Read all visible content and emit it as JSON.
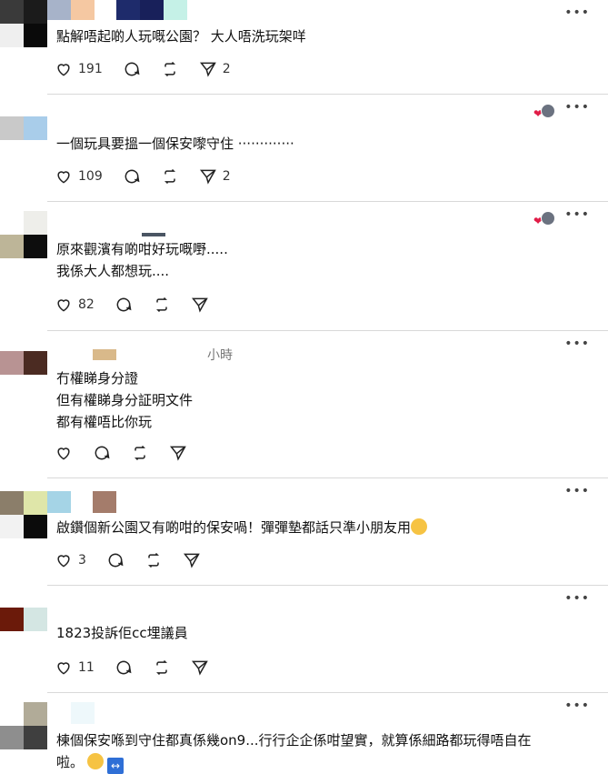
{
  "posts": [
    {
      "text": "點解唔起啲人玩嘅公園？ 大人唔洗玩架咩",
      "likes": "191",
      "shares": "2",
      "has_reactions": false
    },
    {
      "text": "一個玩具要搵一個保安嚟守住 ·············",
      "likes": "109",
      "shares": "2",
      "has_reactions": true
    },
    {
      "text": "原來觀濱有啲咁好玩嘅嘢.....\n我係大人都想玩....",
      "likes": "82",
      "shares": "",
      "has_reactions": true
    },
    {
      "header_time": "小時",
      "text": "冇權睇身分證\n但有權睇身分証明文件\n都有權唔比你玩",
      "likes": "",
      "shares": ""
    },
    {
      "text": "啟鑽個新公園又有啲咁的保安喎！彈彈墊都話只準小朋友用",
      "likes": "3",
      "shares": ""
    },
    {
      "text": "1823投訴佢cc埋議員",
      "likes": "11",
      "shares": ""
    },
    {
      "text": "棟個保安喺到守住都真係幾on9...行行企企係咁望實，就算係細路都玩得唔自在\n啦。",
      "likes": "",
      "shares": ""
    }
  ],
  "icons": {
    "like": "heart-icon",
    "comment": "comment-icon",
    "repost": "repost-icon",
    "share": "share-icon",
    "more": "more-options-icon"
  },
  "colors": {
    "heart": "#e11d48",
    "divider": "#d9d9d9"
  }
}
